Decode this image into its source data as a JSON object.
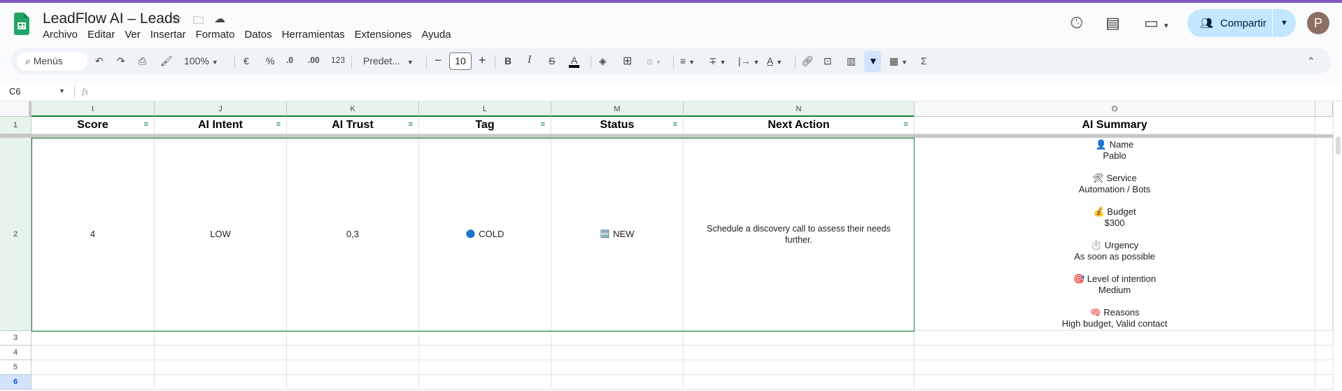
{
  "app": {
    "title": "LeadFlow AI – Leads",
    "menu": [
      "Archivo",
      "Editar",
      "Ver",
      "Insertar",
      "Formato",
      "Datos",
      "Herramientas",
      "Extensiones",
      "Ayuda"
    ],
    "share_label": "Compartir",
    "avatar_letter": "P"
  },
  "toolbar": {
    "search_label": "Menús",
    "zoom": "100%",
    "currency": "€",
    "percent": "%",
    "dec_less": ".0",
    "dec_more": ".00",
    "number_format": "123",
    "font": "Predet...",
    "font_size": "10",
    "bold": "B",
    "italic": "I",
    "strike": "S",
    "text_color": "A",
    "sum": "Σ"
  },
  "formula_bar": {
    "cell_ref": "C6",
    "fx": "fx",
    "value": ""
  },
  "columns": [
    "I",
    "J",
    "K",
    "L",
    "M",
    "N",
    "O"
  ],
  "rows": [
    "1",
    "2",
    "3",
    "4",
    "5",
    "6"
  ],
  "headers": [
    "Score",
    "AI Intent",
    "AI Trust",
    "Tag",
    "Status",
    "Next Action",
    "AI Summary"
  ],
  "row2": {
    "score": "4",
    "intent": "LOW",
    "trust": "0,3",
    "tag": "COLD",
    "tag_icon": "🔵",
    "status": "NEW",
    "status_icon": "🆕",
    "next_action": "Schedule a discovery call to assess their needs further."
  },
  "summary": [
    {
      "icon": "👤",
      "label": "Name",
      "value": "Pablo"
    },
    {
      "icon": "🛠",
      "label": "Service",
      "value": "Automation / Bots"
    },
    {
      "icon": "💰",
      "label": "Budget",
      "value": "$300"
    },
    {
      "icon": "⏱️",
      "label": "Urgency",
      "value": "As soon as possible"
    },
    {
      "icon": "🎯",
      "label": "Level of intention",
      "value": "Medium"
    },
    {
      "icon": "🧠",
      "label": "Reasons",
      "value": "High budget, Valid contact"
    }
  ],
  "colors": {
    "accent": "#188038",
    "share_bg": "#c2e7ff",
    "selected_row": "#d3e3fd"
  }
}
